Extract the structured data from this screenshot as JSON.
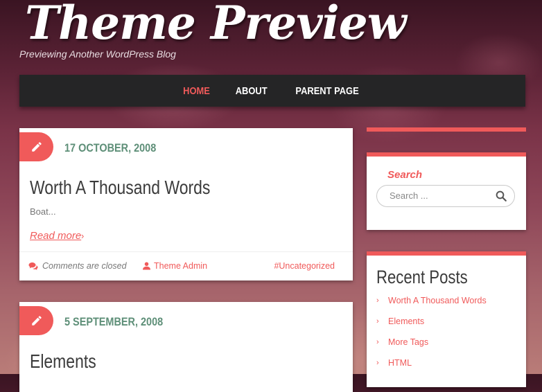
{
  "header": {
    "site_title": "Theme Preview",
    "tagline": "Previewing Another WordPress Blog"
  },
  "nav": {
    "items": [
      {
        "label": "HOME",
        "active": true
      },
      {
        "label": "ABOUT",
        "active": false
      },
      {
        "label": "PARENT PAGE",
        "active": false
      }
    ]
  },
  "posts": [
    {
      "date": "17 OCTOBER, 2008",
      "title": "Worth A Thousand Words",
      "excerpt": "Boat...",
      "read_more": "Read more",
      "read_more_arrow": "›",
      "comments": "Comments are closed",
      "author": "Theme Admin",
      "category": "#Uncategorized",
      "icon": "pencil-icon"
    },
    {
      "date": "5 SEPTEMBER, 2008",
      "title": "Elements",
      "icon": "pencil-icon"
    }
  ],
  "sidebar": {
    "search": {
      "heading": "Search",
      "placeholder": "Search ...",
      "icon": "search-icon"
    },
    "recent_posts": {
      "title": "Recent Posts",
      "bullet": "›",
      "items": [
        "Worth A Thousand Words",
        "Elements",
        "More Tags",
        "HTML"
      ]
    }
  },
  "colors": {
    "accent": "#f05a5a",
    "date_green": "#5e8f78",
    "nav_bg": "#252526"
  }
}
